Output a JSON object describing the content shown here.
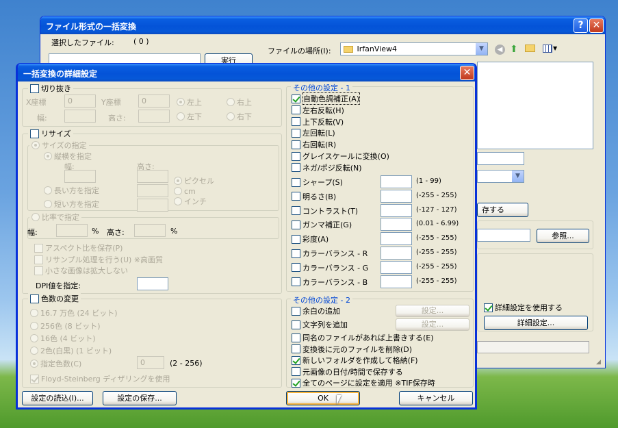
{
  "bg_window": {
    "title": "ファイル形式の一括変換",
    "selected_files_label": "選択したファイル:",
    "selected_count": "( 0 )",
    "run_button": "実行",
    "file_location_label": "ファイルの場所(I):",
    "file_location_value": "IrfanView4",
    "browse_button": "参照...",
    "use_advanced_checkbox": "詳細設定を使用する",
    "advanced_button": "詳細設定...",
    "convert_button_fragment": "存する"
  },
  "dialog": {
    "title": "一括変換の詳細設定",
    "crop": {
      "checkbox": "切り抜き",
      "x_label": "X座標",
      "x_value": "0",
      "y_label": "Y座標",
      "y_value": "0",
      "w_label": "幅:",
      "h_label": "高さ:",
      "anchors": [
        "左上",
        "右上",
        "左下",
        "右下"
      ]
    },
    "resize": {
      "checkbox": "リサイズ",
      "size_spec": "サイズの指定",
      "wh_spec": "縦横を指定",
      "w_label": "幅:",
      "h_label": "高さ:",
      "long_side": "長い方を指定",
      "short_side": "短い方を指定",
      "units": [
        "ピクセル",
        "cm",
        "インチ"
      ],
      "ratio_spec": "比率で指定",
      "ratio_w_label": "幅:",
      "ratio_h_label": "高さ:",
      "percent": "%",
      "keep_aspect": "アスペクト比を保存(P)",
      "resample": "リサンプル処理を行う(U) ※高画質",
      "no_enlarge": "小さな画像は拡大しない",
      "dpi_label": "DPI値を指定:"
    },
    "colors": {
      "checkbox": "色数の変更",
      "options": [
        "16.7 万色 (24 ビット)",
        "256色 (8 ビット)",
        "16色 (4 ビット)",
        "2色(白黒) (1 ビット)",
        "指定色数(C)"
      ],
      "custom_value": "0",
      "custom_range": "(2 - 256)",
      "dither": "Floyd-Steinberg ディザリングを使用"
    },
    "other1": {
      "title": "その他の設定 - 1",
      "checks": [
        "自動色調補正(A)",
        "左右反転(H)",
        "上下反転(V)",
        "左回転(L)",
        "右回転(R)",
        "グレイスケールに変換(O)",
        "ネガ/ポジ反転(N)"
      ],
      "adjust": [
        {
          "label": "シャープ(S)",
          "range": "(1 - 99)"
        },
        {
          "label": "明るさ(B)",
          "range": "(-255 - 255)"
        },
        {
          "label": "コントラスト(T)",
          "range": "(-127 - 127)"
        },
        {
          "label": "ガンマ補正(G)",
          "range": "(0.01 - 6.99)"
        },
        {
          "label": "彩度(A)",
          "range": "(-255 - 255)"
        },
        {
          "label": "カラーバランス - R",
          "range": "(-255 - 255)"
        },
        {
          "label": "カラーバランス - G",
          "range": "(-255 - 255)"
        },
        {
          "label": "カラーバランス - B",
          "range": "(-255 - 255)"
        }
      ]
    },
    "other2": {
      "title": "その他の設定 - 2",
      "margin": "余白の追加",
      "text": "文字列を追加",
      "settings_button": "設定...",
      "checks": [
        "同名のファイルがあれば上書きする(E)",
        "変換後に元のファイルを削除(D)",
        "新しいフォルダを作成して格納(F)",
        "元画像の日付/時間で保存する",
        "全てのページに設定を適用 ※TIF保存時"
      ]
    },
    "buttons": {
      "load": "設定の読込(I)...",
      "save": "設定の保存...",
      "ok": "OK",
      "cancel": "キャンセル"
    }
  }
}
